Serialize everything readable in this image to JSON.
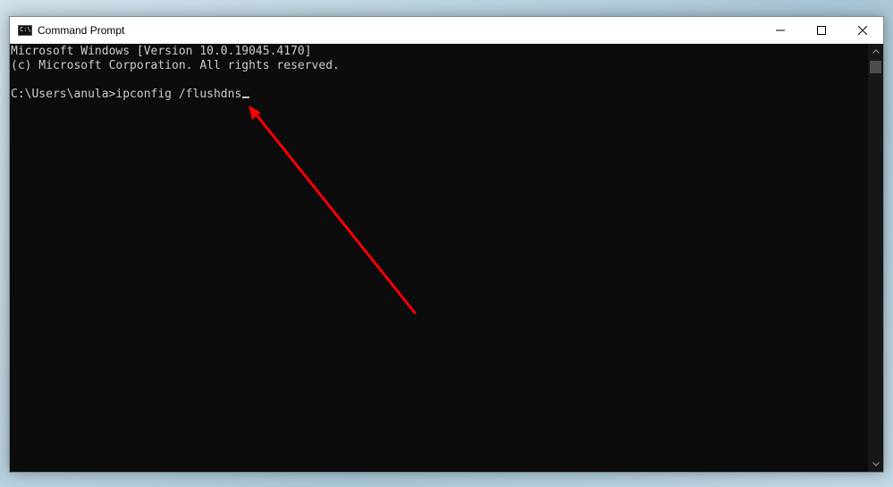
{
  "window": {
    "title": "Command Prompt",
    "icon": "cmd-icon",
    "controls": {
      "minimize_icon": "minimize-icon",
      "maximize_icon": "maximize-icon",
      "close_icon": "close-icon"
    }
  },
  "console": {
    "lines": [
      "Microsoft Windows [Version 10.0.19045.4170]",
      "(c) Microsoft Corporation. All rights reserved.",
      "",
      "C:\\Users\\anula>ipconfig /flushdns"
    ],
    "text_color": "#cccccc",
    "background": "#0c0c0c"
  },
  "annotation": {
    "arrow_color": "#ff0000"
  }
}
